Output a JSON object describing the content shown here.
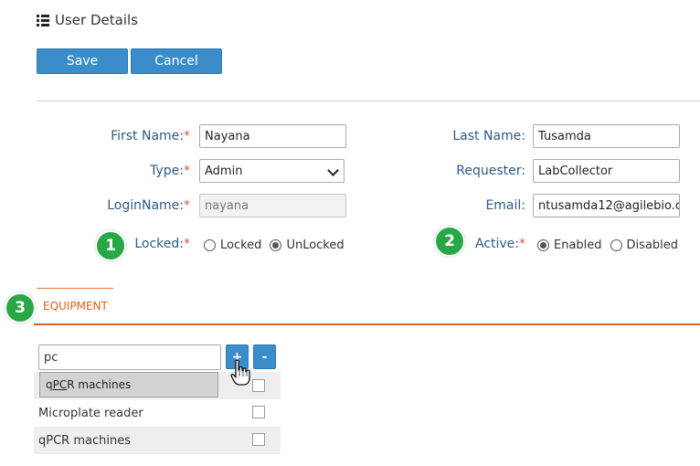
{
  "header": {
    "title": "User Details",
    "icon": "list-icon"
  },
  "toolbar": {
    "save_label": "Save",
    "cancel_label": "Cancel"
  },
  "form": {
    "required_mark": "*",
    "first_name": {
      "label": "First Name:",
      "value": "Nayana"
    },
    "last_name": {
      "label": "Last Name:",
      "value": "Tusamda"
    },
    "type": {
      "label": "Type:",
      "value": "Admin"
    },
    "requester": {
      "label": "Requester:",
      "value": "LabCollector"
    },
    "login_name": {
      "label": "LoginName:",
      "value": "nayana"
    },
    "email": {
      "label": "Email:",
      "value": "ntusamda12@agilebio.c"
    },
    "locked": {
      "label": "Locked:",
      "options": [
        "Locked",
        "UnLocked"
      ],
      "selected": "UnLocked"
    },
    "active": {
      "label": "Active:",
      "options": [
        "Enabled",
        "Disabled"
      ],
      "selected": "Enabled"
    }
  },
  "badges": [
    "1",
    "2",
    "3"
  ],
  "equipment": {
    "tab_label": "EQUIPMENT",
    "search_value": "pc",
    "add_label": "+",
    "remove_label": "-",
    "suggestion": {
      "prefix": "q",
      "match": "PC",
      "suffix": "R machines"
    },
    "rows": [
      {
        "name": "",
        "checked": false
      },
      {
        "name": "Microplate reader",
        "checked": false
      },
      {
        "name": "qPCR machines",
        "checked": false
      }
    ]
  },
  "colors": {
    "button": "#3b8dc9",
    "label": "#2c5a85",
    "required": "#d9534f",
    "tab_accent": "#d9661f",
    "badge": "#28a745"
  }
}
